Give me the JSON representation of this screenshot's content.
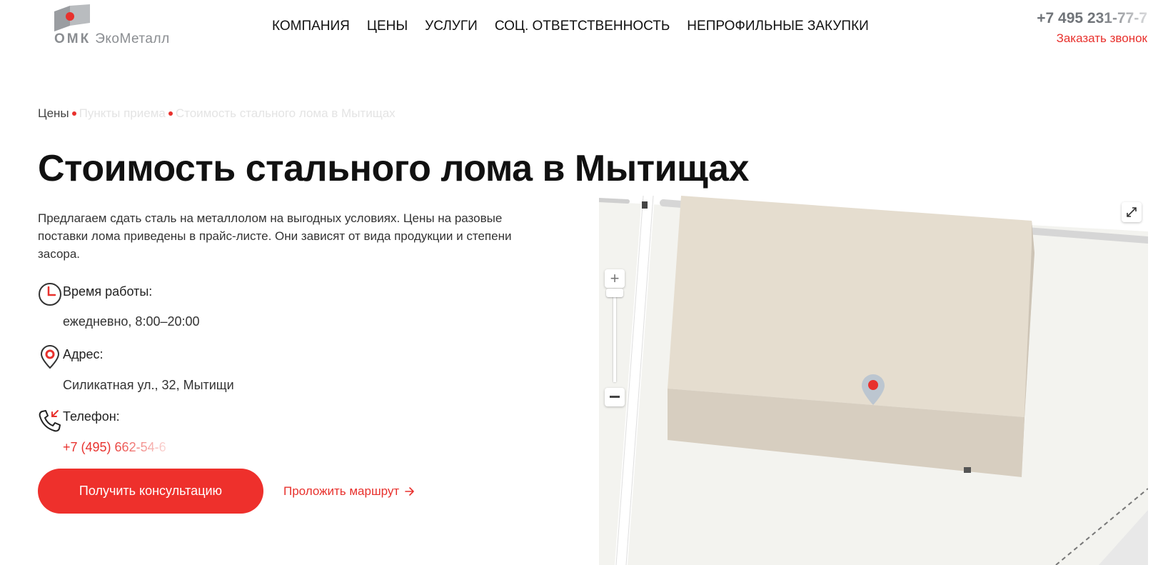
{
  "header": {
    "logo": {
      "brand": "ОМК",
      "name": "ЭкоМеталл"
    },
    "nav": [
      {
        "label": "КОМПАНИЯ"
      },
      {
        "label": "ЦЕНЫ"
      },
      {
        "label": "УСЛУГИ"
      },
      {
        "label": "СОЦ. ОТВЕТСТВЕННОСТЬ"
      },
      {
        "label": "НЕПРОФИЛЬНЫЕ ЗАКУПКИ"
      }
    ],
    "phone": "+7 495 231-77-7",
    "callback_label": "Заказать звонок"
  },
  "breadcrumb": {
    "items": [
      "Цены",
      "Пункты приема",
      "Стоимость стального лома в Мытищах"
    ]
  },
  "page": {
    "title": "Стоимость стального лома в Мытищах",
    "description": "Предлагаем сдать сталь на металлолом на выгодных условиях. Цены на разовые поставки лома приведены в прайс-листе. Они зависят от вида продукции и степени засора."
  },
  "info": {
    "hours": {
      "label": "Время работы:",
      "value": "ежедневно, 8:00–20:00",
      "icon": "clock-icon"
    },
    "address": {
      "label": "Адрес:",
      "value": "Силикатная ул., 32, Мытищи",
      "icon": "location-pin-icon"
    },
    "phone": {
      "label": "Телефон:",
      "value": "+7 (495) 662-54-6",
      "icon": "phone-icon"
    }
  },
  "actions": {
    "consult_label": "Получить консультацию",
    "route_label": "Проложить маршрут"
  },
  "map": {
    "zoom_in": "+",
    "zoom_out": "−"
  },
  "colors": {
    "accent": "#e8312d",
    "button": "#ee302c",
    "text": "#111111",
    "logo_gray": "#8a8d91"
  }
}
